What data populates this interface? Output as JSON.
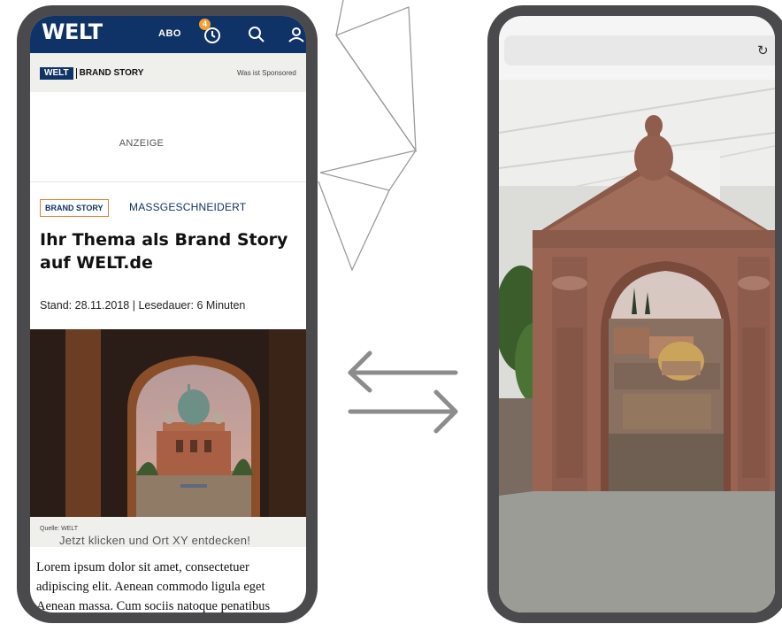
{
  "left_phone": {
    "header": {
      "logo": "WELT",
      "abo_label": "ABO",
      "badge_count": "4",
      "icons": [
        "clock-icon",
        "search-icon",
        "user-icon"
      ]
    },
    "brand_bar": {
      "logo_mini": "WELT",
      "logo_text": "BRAND STORY",
      "sponsored_link": "Was ist Sponsored"
    },
    "ad_label": "ANZEIGE",
    "article": {
      "tag": "BRAND STORY",
      "category": "MASSGESCHNEIDERT",
      "headline": "Ihr Thema als Brand Story auf WELT.de",
      "meta": "Stand: 28.11.2018 | Lesedauer: 6 Minuten",
      "image_source": "Quelle: WELT",
      "cta": "Jetzt klicken und Ort XY entdecken!",
      "body_lines": [
        "Lorem ipsum dolor sit amet, consectetuer",
        "adipiscing elit. Aenean commodo ligula eget",
        "Aenean massa. Cum sociis natoque penatibus"
      ]
    }
  },
  "right_phone": {
    "reload_icon": "reload-icon",
    "reload_glyph": "↻"
  },
  "colors": {
    "welt_blue": "#0f3366",
    "tag_orange": "#e27f2f",
    "phone_frame": "#4a4a4d"
  }
}
